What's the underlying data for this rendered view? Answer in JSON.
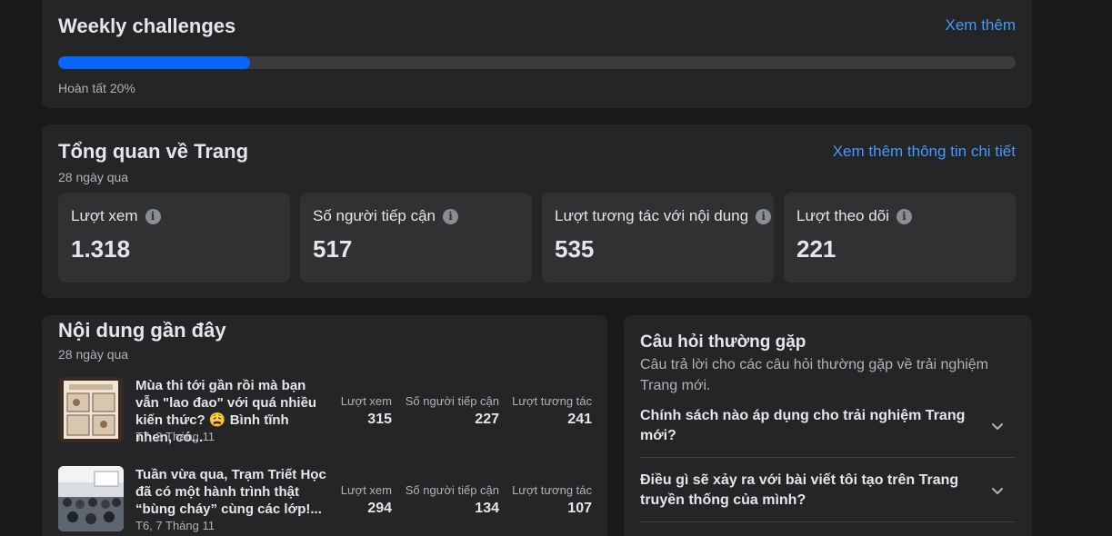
{
  "weekly": {
    "title": "Weekly challenges",
    "link": "Xem thêm",
    "progress": 0.2,
    "progress_label": "Hoàn tất 20%",
    "accent": "#0866ff"
  },
  "overview": {
    "title": "Tổng quan về Trang",
    "subtitle": "28 ngày qua",
    "link": "Xem thêm thông tin chi tiết",
    "stats": [
      {
        "label": "Lượt xem",
        "value": "1.318",
        "icon": "info-icon"
      },
      {
        "label": "Số người tiếp cận",
        "value": "517",
        "icon": "info-icon"
      },
      {
        "label": "Lượt tương tác với nội dung",
        "value": "535",
        "icon": "info-icon"
      },
      {
        "label": "Lượt theo dõi",
        "value": "221",
        "icon": "info-icon"
      }
    ]
  },
  "recent": {
    "title": "Nội dung gần đây",
    "subtitle": "28 ngày qua",
    "metric_labels": [
      "Lượt xem",
      "Số người tiếp cận",
      "Lượt tương tác"
    ],
    "posts": [
      {
        "text": "Mùa thi tới gần rồi mà bạn vẫn \"lao đao\" với quá nhiều kiến thức? 😩 Bình tĩnh nhen, có...",
        "date": "T7, 8 Tháng 11",
        "views": "315",
        "reach": "227",
        "engagement": "241"
      },
      {
        "text": "Tuần vừa qua, Trạm Triết Học đã có một hành trình thật “bùng cháy” cùng các lớp!...",
        "date": "T6, 7 Tháng 11",
        "views": "294",
        "reach": "134",
        "engagement": "107"
      }
    ]
  },
  "faq": {
    "title": "Câu hỏi thường gặp",
    "description": "Câu trả lời cho các câu hỏi thường gặp về trải nghiệm Trang mới.",
    "items": [
      {
        "question": "Chính sách nào áp dụng cho trải nghiệm Trang mới?",
        "icon": "chevron-down-icon"
      },
      {
        "question": "Điều gì sẽ xảy ra với bài viết tôi tạo trên Trang truyền thống của mình?",
        "icon": "chevron-down-icon"
      }
    ]
  }
}
